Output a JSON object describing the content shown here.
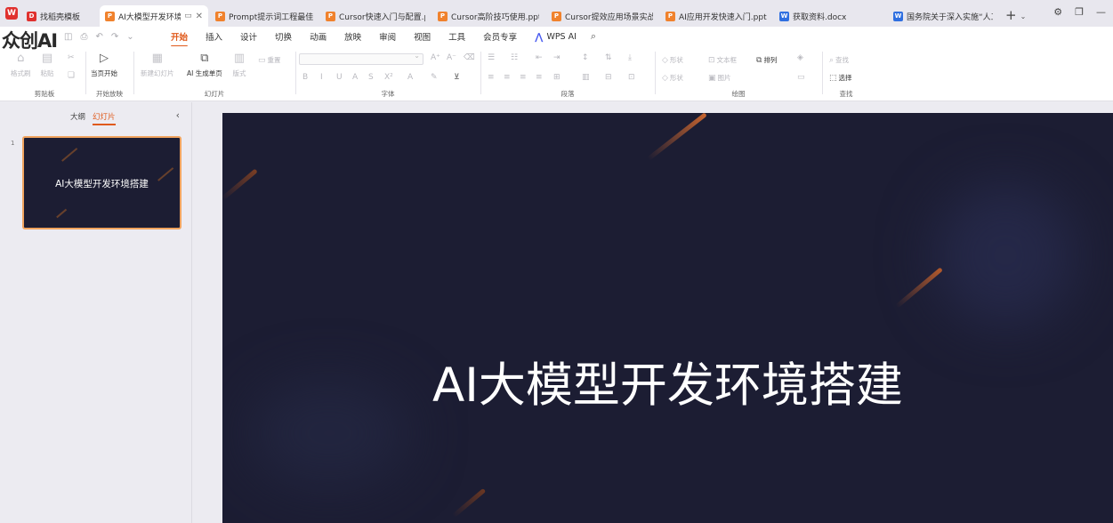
{
  "watermark": "众创AI",
  "tabs": [
    {
      "label": "找稻壳模板",
      "type": "t"
    },
    {
      "label": "AI大模型开发环境指",
      "type": "p",
      "active": true
    },
    {
      "label": "Prompt提示词工程最佳实",
      "type": "p"
    },
    {
      "label": "Cursor快速入门与配置.ppt",
      "type": "p"
    },
    {
      "label": "Cursor高阶技巧使用.pptx",
      "type": "p"
    },
    {
      "label": "Cursor提效应用场景实战.p",
      "type": "p"
    },
    {
      "label": "AI应用开发快速入门.pptx",
      "type": "p"
    },
    {
      "label": "获取资料.docx",
      "type": "w"
    },
    {
      "label": "国务院关于深入实施“人工",
      "type": "w"
    }
  ],
  "menu": {
    "items": [
      "开始",
      "插入",
      "设计",
      "切换",
      "动画",
      "放映",
      "审阅",
      "视图",
      "工具",
      "会员专享"
    ],
    "active": "开始",
    "ai_label": "WPS AI"
  },
  "ribbon": {
    "clipboard": {
      "group": "剪贴板",
      "format_painter": "格式刷",
      "paste": "粘贴"
    },
    "slideshow": {
      "group": "开始放映",
      "from_current": "当页开始"
    },
    "slides": {
      "group": "幻灯片",
      "new_slide": "新建幻灯片",
      "ai_page": "AI 生成单页",
      "layout": "版式",
      "reset": "重置"
    },
    "font": {
      "group": "字体"
    },
    "paragraph": {
      "group": "段落"
    },
    "drawing": {
      "group": "绘图",
      "shape": "形状",
      "textbox": "文本框",
      "arrange": "排列",
      "picture": "图片"
    },
    "find": {
      "group": "查找",
      "find": "查找",
      "select": "选择"
    }
  },
  "sidebar": {
    "tab_outline": "大纲",
    "tab_slides": "幻灯片",
    "active_tab": "幻灯片",
    "slide_number": "1",
    "thumb_title": "AI大模型开发环境搭建"
  },
  "slide": {
    "title": "AI大模型开发环境搭建",
    "background": "#1c1d33",
    "accent": "#c8652f"
  }
}
